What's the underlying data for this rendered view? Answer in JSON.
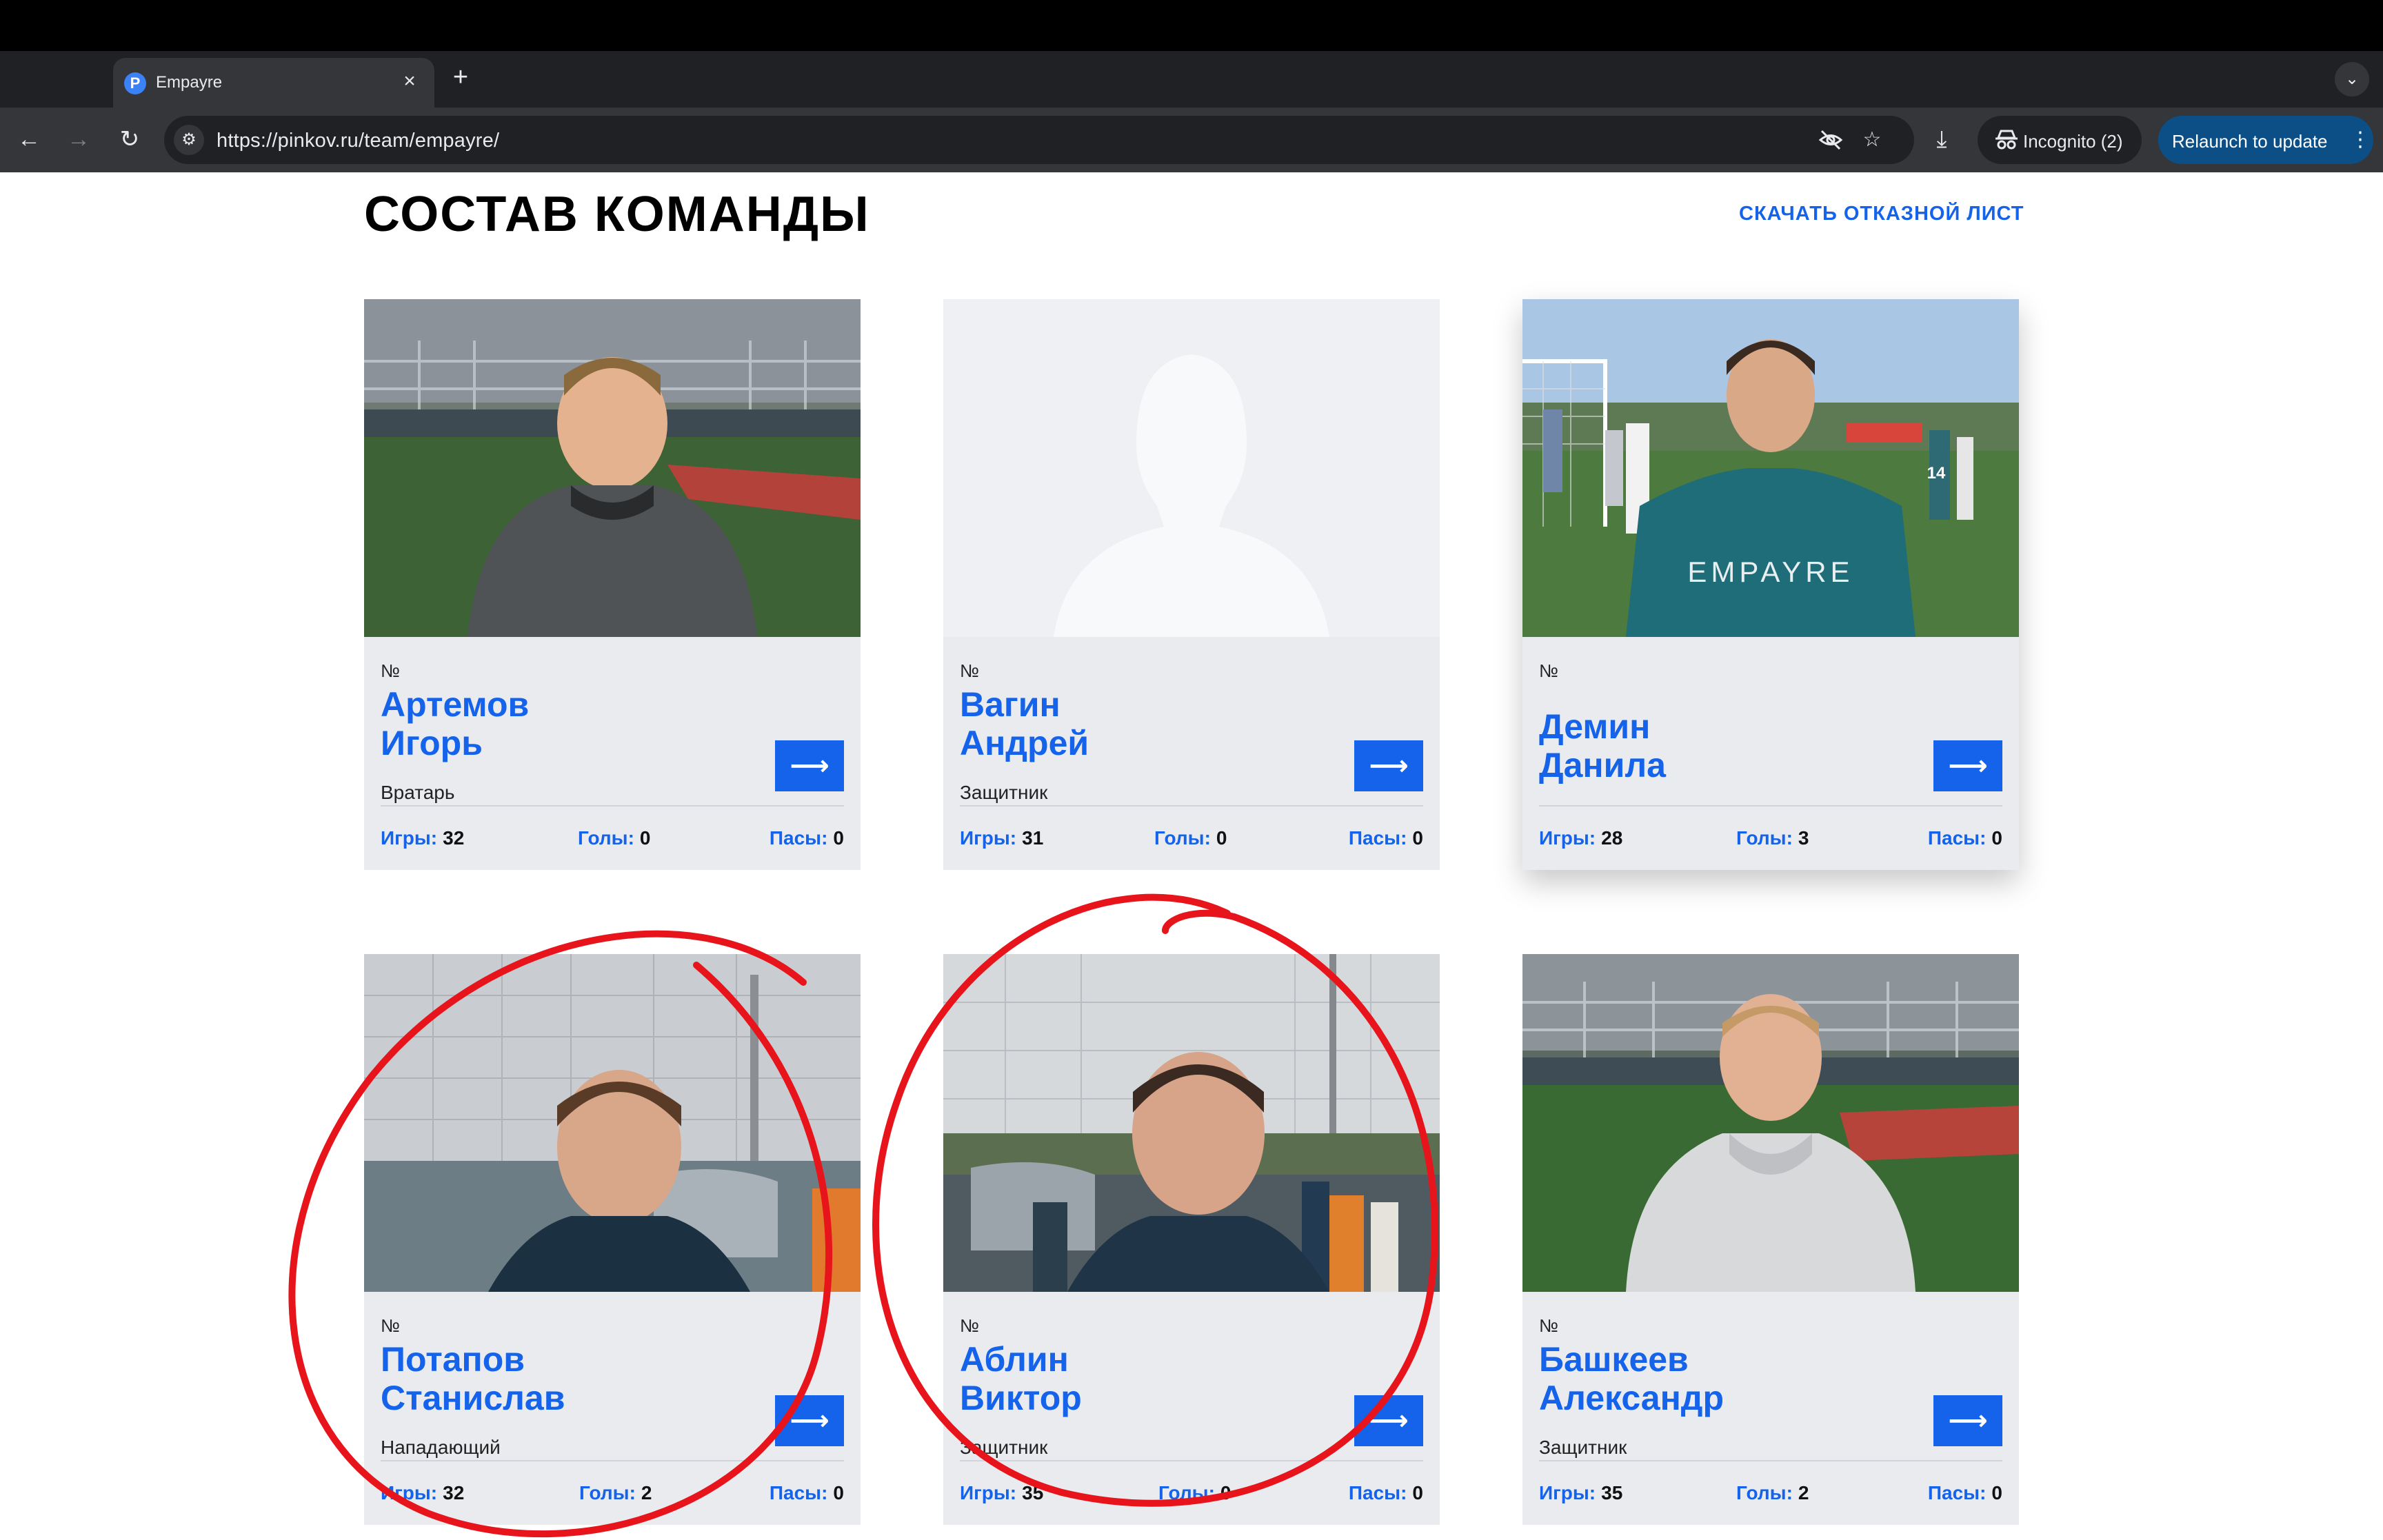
{
  "browser": {
    "tab_title": "Empayre",
    "tab_favicon_letter": "P",
    "url": "https://pinkov.ru/team/empayre/",
    "incognito_label": "Incognito (2)",
    "relaunch_label": "Relaunch to update"
  },
  "page": {
    "title": "СОСТАВ КОМАНДЫ",
    "waiver_link": "СКАЧАТЬ ОТКАЗНОЙ ЛИСТ"
  },
  "stat_labels": {
    "games": "Игры:",
    "goals": "Голы:",
    "assists": "Пасы:"
  },
  "players": [
    {
      "num_label": "№",
      "first": "Артемов",
      "last": "Игорь",
      "role": "Вратарь",
      "games": "32",
      "goals": "0",
      "assists": "0"
    },
    {
      "num_label": "№",
      "first": "Вагин",
      "last": "Андрей",
      "role": "Защитник",
      "games": "31",
      "goals": "0",
      "assists": "0"
    },
    {
      "num_label": "№",
      "first": "Демин",
      "last": "Данила",
      "role": "",
      "games": "28",
      "goals": "3",
      "assists": "0"
    },
    {
      "num_label": "№",
      "first": "Потапов",
      "last": "Станислав",
      "role": "Нападающий",
      "games": "32",
      "goals": "2",
      "assists": "0"
    },
    {
      "num_label": "№",
      "first": "Аблин",
      "last": "Виктор",
      "role": "Защитник",
      "games": "35",
      "goals": "0",
      "assists": "0"
    },
    {
      "num_label": "№",
      "first": "Башкеев",
      "last": "Александр",
      "role": "Защитник",
      "games": "35",
      "goals": "2",
      "assists": "0"
    }
  ],
  "jersey_text": "EMPAYRE",
  "jersey_number": "14",
  "arrow_glyph": "⟶",
  "colors": {
    "accent": "#1463ea",
    "annotation": "#e8141b"
  }
}
